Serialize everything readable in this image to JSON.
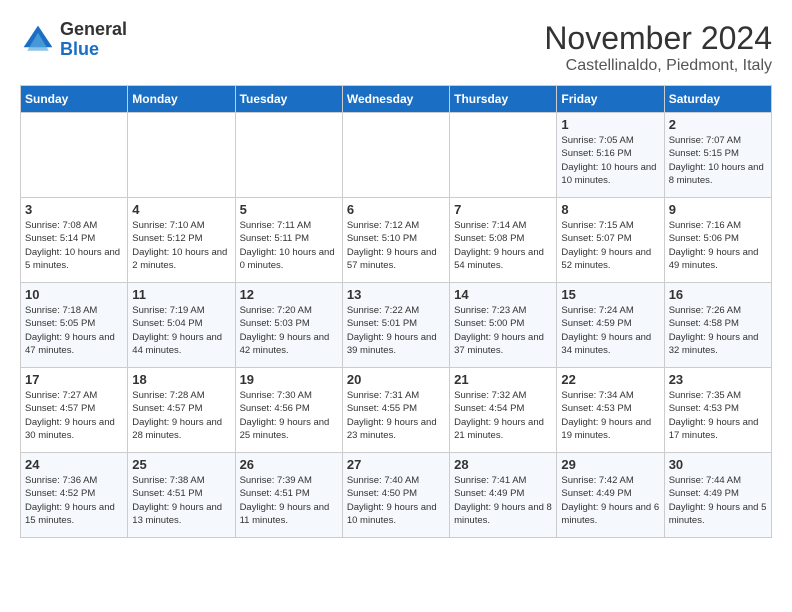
{
  "logo": {
    "line1": "General",
    "line2": "Blue"
  },
  "title": "November 2024",
  "location": "Castellinaldo, Piedmont, Italy",
  "weekdays": [
    "Sunday",
    "Monday",
    "Tuesday",
    "Wednesday",
    "Thursday",
    "Friday",
    "Saturday"
  ],
  "weeks": [
    [
      {
        "day": "",
        "info": ""
      },
      {
        "day": "",
        "info": ""
      },
      {
        "day": "",
        "info": ""
      },
      {
        "day": "",
        "info": ""
      },
      {
        "day": "",
        "info": ""
      },
      {
        "day": "1",
        "info": "Sunrise: 7:05 AM\nSunset: 5:16 PM\nDaylight: 10 hours and 10 minutes."
      },
      {
        "day": "2",
        "info": "Sunrise: 7:07 AM\nSunset: 5:15 PM\nDaylight: 10 hours and 8 minutes."
      }
    ],
    [
      {
        "day": "3",
        "info": "Sunrise: 7:08 AM\nSunset: 5:14 PM\nDaylight: 10 hours and 5 minutes."
      },
      {
        "day": "4",
        "info": "Sunrise: 7:10 AM\nSunset: 5:12 PM\nDaylight: 10 hours and 2 minutes."
      },
      {
        "day": "5",
        "info": "Sunrise: 7:11 AM\nSunset: 5:11 PM\nDaylight: 10 hours and 0 minutes."
      },
      {
        "day": "6",
        "info": "Sunrise: 7:12 AM\nSunset: 5:10 PM\nDaylight: 9 hours and 57 minutes."
      },
      {
        "day": "7",
        "info": "Sunrise: 7:14 AM\nSunset: 5:08 PM\nDaylight: 9 hours and 54 minutes."
      },
      {
        "day": "8",
        "info": "Sunrise: 7:15 AM\nSunset: 5:07 PM\nDaylight: 9 hours and 52 minutes."
      },
      {
        "day": "9",
        "info": "Sunrise: 7:16 AM\nSunset: 5:06 PM\nDaylight: 9 hours and 49 minutes."
      }
    ],
    [
      {
        "day": "10",
        "info": "Sunrise: 7:18 AM\nSunset: 5:05 PM\nDaylight: 9 hours and 47 minutes."
      },
      {
        "day": "11",
        "info": "Sunrise: 7:19 AM\nSunset: 5:04 PM\nDaylight: 9 hours and 44 minutes."
      },
      {
        "day": "12",
        "info": "Sunrise: 7:20 AM\nSunset: 5:03 PM\nDaylight: 9 hours and 42 minutes."
      },
      {
        "day": "13",
        "info": "Sunrise: 7:22 AM\nSunset: 5:01 PM\nDaylight: 9 hours and 39 minutes."
      },
      {
        "day": "14",
        "info": "Sunrise: 7:23 AM\nSunset: 5:00 PM\nDaylight: 9 hours and 37 minutes."
      },
      {
        "day": "15",
        "info": "Sunrise: 7:24 AM\nSunset: 4:59 PM\nDaylight: 9 hours and 34 minutes."
      },
      {
        "day": "16",
        "info": "Sunrise: 7:26 AM\nSunset: 4:58 PM\nDaylight: 9 hours and 32 minutes."
      }
    ],
    [
      {
        "day": "17",
        "info": "Sunrise: 7:27 AM\nSunset: 4:57 PM\nDaylight: 9 hours and 30 minutes."
      },
      {
        "day": "18",
        "info": "Sunrise: 7:28 AM\nSunset: 4:57 PM\nDaylight: 9 hours and 28 minutes."
      },
      {
        "day": "19",
        "info": "Sunrise: 7:30 AM\nSunset: 4:56 PM\nDaylight: 9 hours and 25 minutes."
      },
      {
        "day": "20",
        "info": "Sunrise: 7:31 AM\nSunset: 4:55 PM\nDaylight: 9 hours and 23 minutes."
      },
      {
        "day": "21",
        "info": "Sunrise: 7:32 AM\nSunset: 4:54 PM\nDaylight: 9 hours and 21 minutes."
      },
      {
        "day": "22",
        "info": "Sunrise: 7:34 AM\nSunset: 4:53 PM\nDaylight: 9 hours and 19 minutes."
      },
      {
        "day": "23",
        "info": "Sunrise: 7:35 AM\nSunset: 4:53 PM\nDaylight: 9 hours and 17 minutes."
      }
    ],
    [
      {
        "day": "24",
        "info": "Sunrise: 7:36 AM\nSunset: 4:52 PM\nDaylight: 9 hours and 15 minutes."
      },
      {
        "day": "25",
        "info": "Sunrise: 7:38 AM\nSunset: 4:51 PM\nDaylight: 9 hours and 13 minutes."
      },
      {
        "day": "26",
        "info": "Sunrise: 7:39 AM\nSunset: 4:51 PM\nDaylight: 9 hours and 11 minutes."
      },
      {
        "day": "27",
        "info": "Sunrise: 7:40 AM\nSunset: 4:50 PM\nDaylight: 9 hours and 10 minutes."
      },
      {
        "day": "28",
        "info": "Sunrise: 7:41 AM\nSunset: 4:49 PM\nDaylight: 9 hours and 8 minutes."
      },
      {
        "day": "29",
        "info": "Sunrise: 7:42 AM\nSunset: 4:49 PM\nDaylight: 9 hours and 6 minutes."
      },
      {
        "day": "30",
        "info": "Sunrise: 7:44 AM\nSunset: 4:49 PM\nDaylight: 9 hours and 5 minutes."
      }
    ]
  ]
}
